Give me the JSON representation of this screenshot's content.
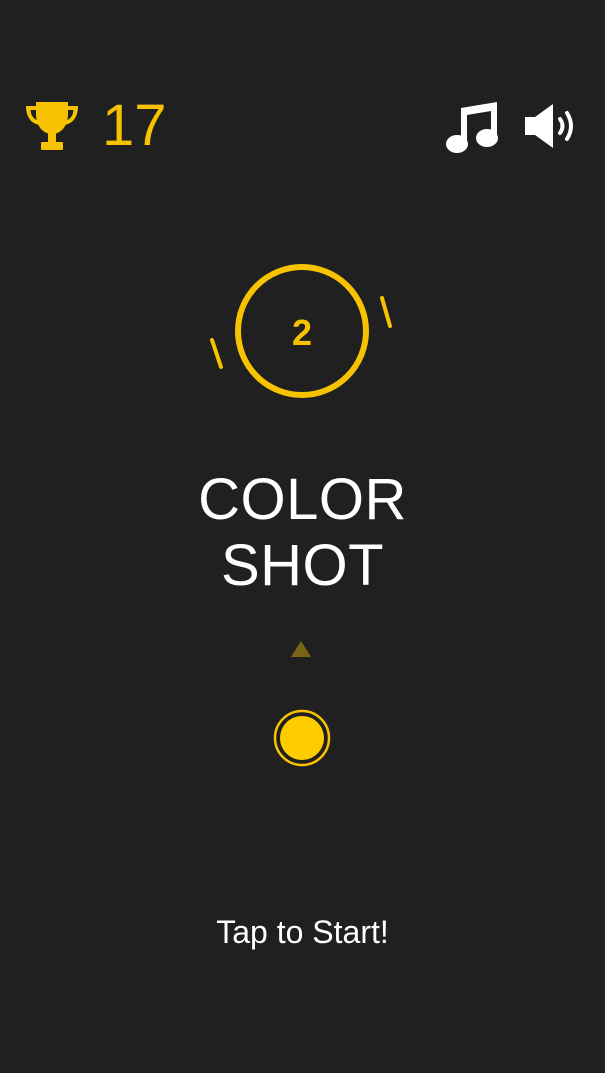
{
  "hud": {
    "best_score": "17",
    "trophy_icon": "trophy-icon",
    "music_icon": "music-note-icon",
    "sound_icon": "speaker-volume-icon"
  },
  "target": {
    "level": "2"
  },
  "title": {
    "line1": "COLOR",
    "line2": "SHOT"
  },
  "start_prompt": "Tap to Start!",
  "colors": {
    "background": "#202020",
    "accent": "#f7c200",
    "aim_arrow": "#7a6514",
    "text": "#ffffff"
  }
}
